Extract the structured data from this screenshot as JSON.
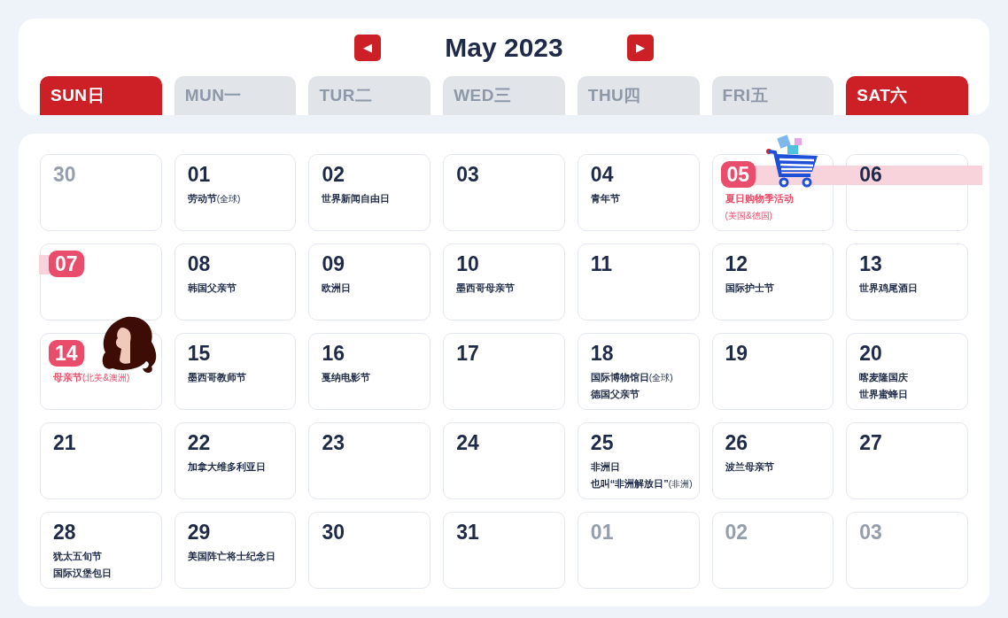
{
  "header": {
    "prev": "◀",
    "title": "May 2023",
    "next": "▶"
  },
  "weekdays": [
    {
      "label": "SUN日",
      "weekend": true
    },
    {
      "label": "MUN一",
      "weekend": false
    },
    {
      "label": "TUR二",
      "weekend": false
    },
    {
      "label": "WED三",
      "weekend": false
    },
    {
      "label": "THU四",
      "weekend": false
    },
    {
      "label": "FRI五",
      "weekend": false
    },
    {
      "label": "SAT六",
      "weekend": true
    }
  ],
  "days": [
    {
      "number": "30",
      "kind": "plain",
      "muted": true,
      "highlight": false,
      "band": false
    },
    {
      "number": "01",
      "kind": "plain",
      "muted": false,
      "highlight": false,
      "band": false,
      "notes": [
        {
          "text": "劳动节",
          "tag": "(全球)"
        }
      ]
    },
    {
      "number": "02",
      "kind": "plain",
      "muted": false,
      "highlight": false,
      "band": false,
      "notes": [
        {
          "text": "世界新闻自由日"
        }
      ]
    },
    {
      "number": "03",
      "kind": "plain",
      "muted": false,
      "highlight": false,
      "band": false
    },
    {
      "number": "04",
      "kind": "plain",
      "muted": false,
      "highlight": false,
      "band": false,
      "notes": [
        {
          "text": "青年节"
        }
      ]
    },
    {
      "number": "05",
      "kind": "shopping",
      "muted": false,
      "highlight": true,
      "band": true,
      "notes": [
        {
          "text": "夏日购物季活动"
        },
        {
          "tag": "(美国&德国)"
        }
      ]
    },
    {
      "number": "06",
      "kind": "plain",
      "muted": false,
      "highlight": false,
      "band": true
    },
    {
      "number": "07",
      "kind": "plain",
      "muted": false,
      "highlight": true,
      "band": true
    },
    {
      "number": "08",
      "kind": "plain",
      "muted": false,
      "highlight": false,
      "band": false,
      "notes": [
        {
          "text": "韩国父亲节"
        }
      ]
    },
    {
      "number": "09",
      "kind": "plain",
      "muted": false,
      "highlight": false,
      "band": false,
      "notes": [
        {
          "text": "欧洲日"
        }
      ]
    },
    {
      "number": "10",
      "kind": "plain",
      "muted": false,
      "highlight": false,
      "band": false,
      "notes": [
        {
          "text": "墨西哥母亲节"
        }
      ]
    },
    {
      "number": "11",
      "kind": "plain",
      "muted": false,
      "highlight": false,
      "band": false
    },
    {
      "number": "12",
      "kind": "plain",
      "muted": false,
      "highlight": false,
      "band": false,
      "notes": [
        {
          "text": "国际护士节"
        }
      ]
    },
    {
      "number": "13",
      "kind": "plain",
      "muted": false,
      "highlight": false,
      "band": false,
      "notes": [
        {
          "text": "世界鸡尾酒日"
        }
      ]
    },
    {
      "number": "14",
      "kind": "portrait",
      "muted": false,
      "highlight": true,
      "band": false,
      "notes": [
        {
          "text": "母亲节",
          "tag": "(北美&澳洲)"
        }
      ]
    },
    {
      "number": "15",
      "kind": "plain",
      "muted": false,
      "highlight": false,
      "band": false,
      "notes": [
        {
          "text": "墨西哥教师节"
        }
      ]
    },
    {
      "number": "16",
      "kind": "plain",
      "muted": false,
      "highlight": false,
      "band": false,
      "notes": [
        {
          "text": "戛纳电影节"
        }
      ]
    },
    {
      "number": "17",
      "kind": "plain",
      "muted": false,
      "highlight": false,
      "band": false
    },
    {
      "number": "18",
      "kind": "plain",
      "muted": false,
      "highlight": false,
      "band": false,
      "notes": [
        {
          "text": "国际博物馆日",
          "tag": "(全球)"
        },
        {
          "text": "德国父亲节"
        }
      ]
    },
    {
      "number": "19",
      "kind": "plain",
      "muted": false,
      "highlight": false,
      "band": false
    },
    {
      "number": "20",
      "kind": "plain",
      "muted": false,
      "highlight": false,
      "band": false,
      "notes": [
        {
          "text": "喀麦隆国庆"
        },
        {
          "text": "世界蜜蜂日"
        }
      ]
    },
    {
      "number": "21",
      "kind": "plain",
      "muted": false,
      "highlight": false,
      "band": false
    },
    {
      "number": "22",
      "kind": "plain",
      "muted": false,
      "highlight": false,
      "band": false,
      "notes": [
        {
          "text": "加拿大维多利亚日"
        }
      ]
    },
    {
      "number": "23",
      "kind": "plain",
      "muted": false,
      "highlight": false,
      "band": false
    },
    {
      "number": "24",
      "kind": "plain",
      "muted": false,
      "highlight": false,
      "band": false
    },
    {
      "number": "25",
      "kind": "plain",
      "muted": false,
      "highlight": false,
      "band": false,
      "notes": [
        {
          "text": "非洲日"
        },
        {
          "text": "也叫“非洲解放日”",
          "tag": "(非洲)"
        }
      ]
    },
    {
      "number": "26",
      "kind": "plain",
      "muted": false,
      "highlight": false,
      "band": false,
      "notes": [
        {
          "text": "波兰母亲节"
        }
      ]
    },
    {
      "number": "27",
      "kind": "plain",
      "muted": false,
      "highlight": false,
      "band": false
    },
    {
      "number": "28",
      "kind": "plain",
      "muted": false,
      "highlight": false,
      "band": false,
      "notes": [
        {
          "text": "犹太五旬节"
        },
        {
          "text": "国际汉堡包日"
        }
      ]
    },
    {
      "number": "29",
      "kind": "plain",
      "muted": false,
      "highlight": false,
      "band": false,
      "notes": [
        {
          "text": "美国阵亡将士纪念日"
        }
      ]
    },
    {
      "number": "30",
      "kind": "plain",
      "muted": false,
      "highlight": false,
      "band": false
    },
    {
      "number": "31",
      "kind": "plain",
      "muted": false,
      "highlight": false,
      "band": false
    },
    {
      "number": "01",
      "kind": "plain",
      "muted": true,
      "highlight": false,
      "band": false
    },
    {
      "number": "02",
      "kind": "plain",
      "muted": true,
      "highlight": false,
      "band": false
    },
    {
      "number": "03",
      "kind": "plain",
      "muted": true,
      "highlight": false,
      "band": false
    }
  ]
}
